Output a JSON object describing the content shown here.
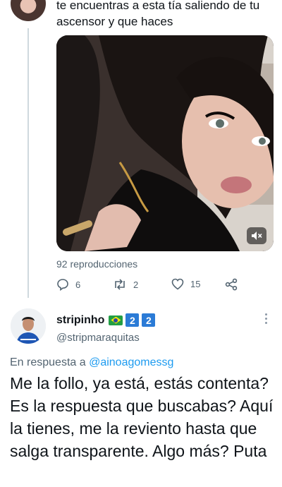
{
  "tweet": {
    "text": "te encuentras a esta tía saliendo de tu ascensor y que haces",
    "views": "92 reproducciones",
    "actions": {
      "replies": "6",
      "retweets": "2",
      "likes": "15"
    }
  },
  "reply": {
    "name": "stripinho",
    "badges": [
      "2",
      "2"
    ],
    "handle": "@stripmaraquitas",
    "replying_prefix": "En respuesta a",
    "replying_mention": "@ainoagomessg",
    "text": "Me la follo, ya está, estás contenta? Es la respuesta que buscabas? Aquí la tienes, me la reviento hasta que salga transparente. Algo más? Puta"
  },
  "icons": {
    "reply": "comment-icon",
    "retweet": "retweet-icon",
    "like": "heart-icon",
    "share": "share-icon",
    "mute": "volume-muted-icon",
    "more": "more-vertical-icon"
  },
  "colors": {
    "text": "#0f1419",
    "secondary": "#536471",
    "link": "#1d9bf0",
    "thread_line": "#cfd9de",
    "badge_blue": "#2b7bd6"
  }
}
